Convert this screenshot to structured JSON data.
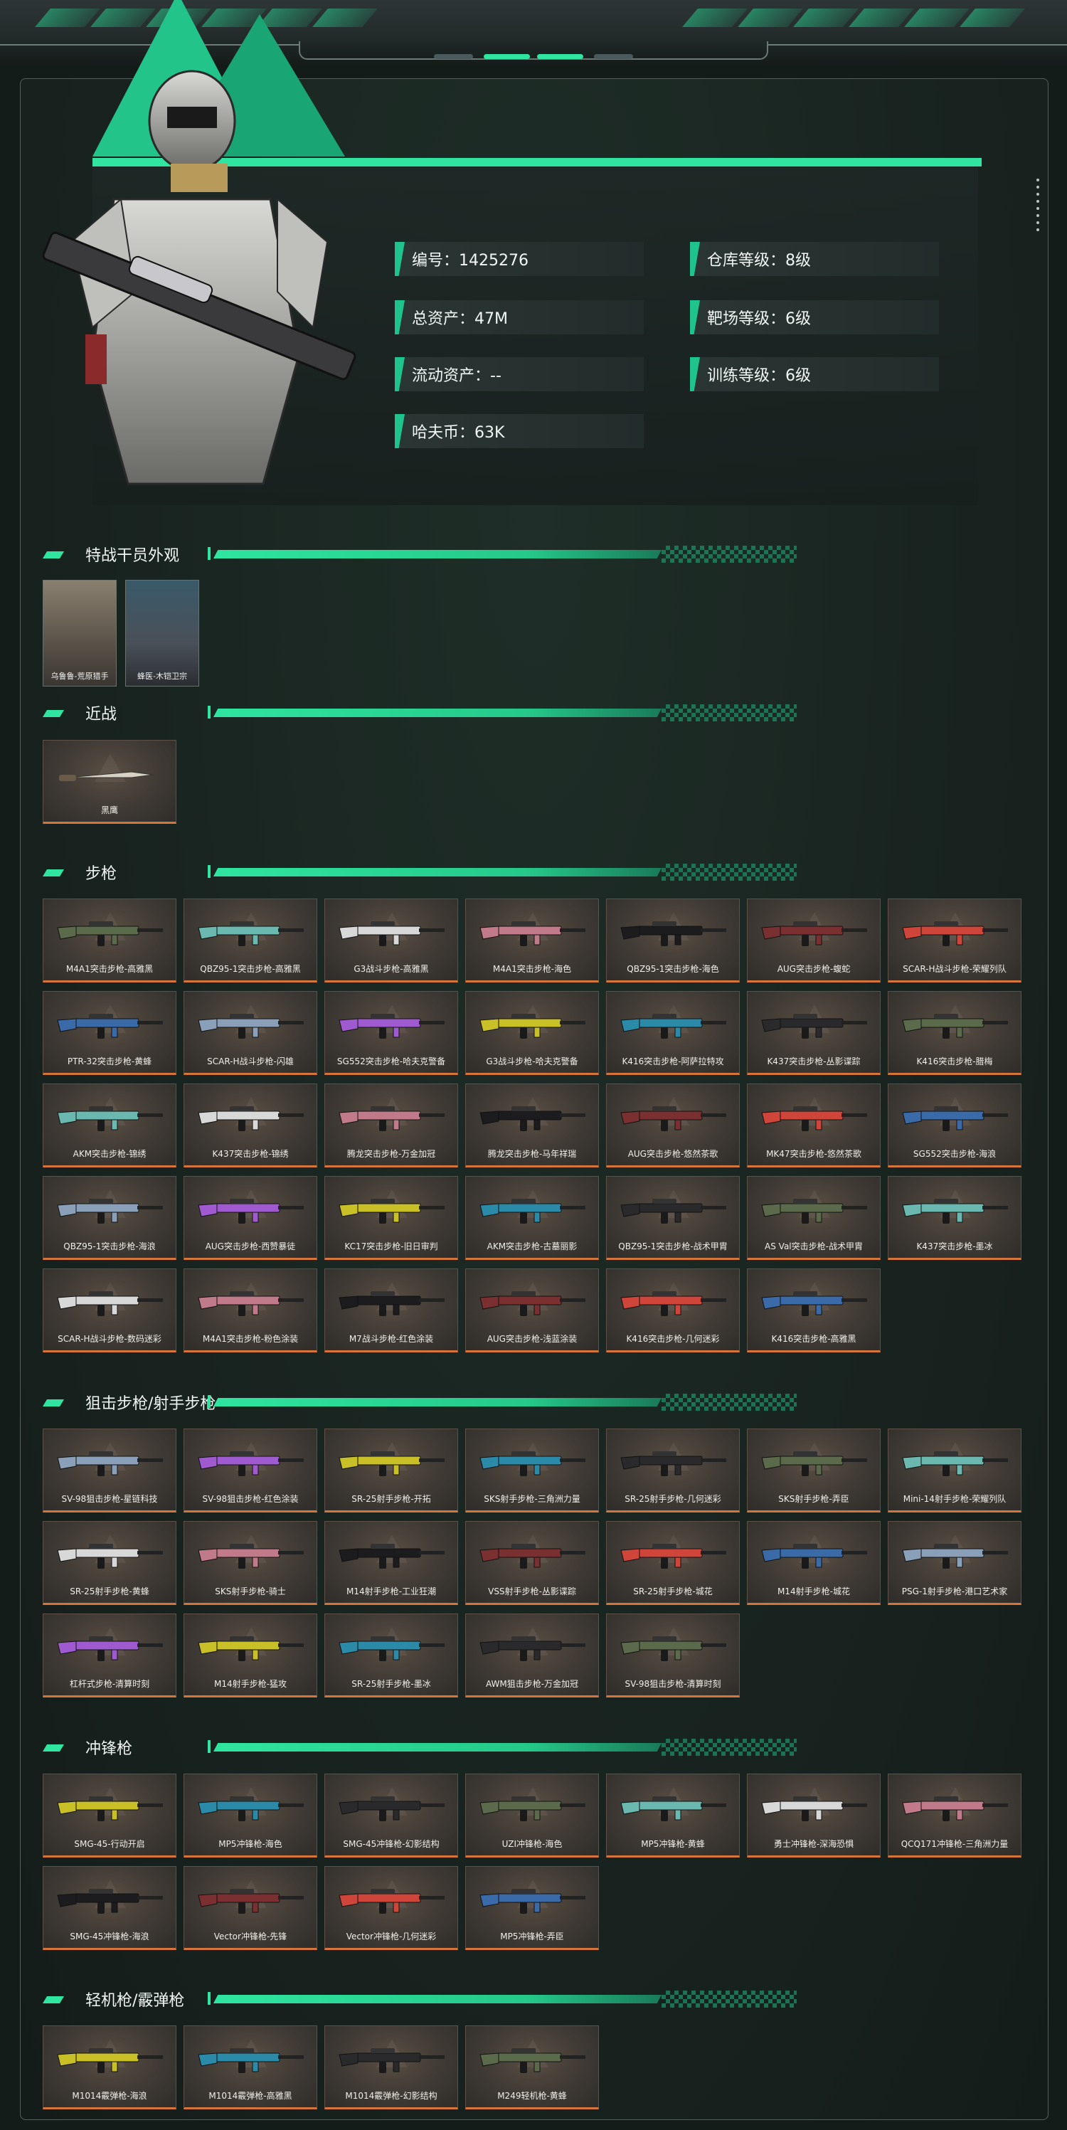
{
  "stats": [
    {
      "label": "编号：1425276"
    },
    {
      "label": "仓库等级：8级"
    },
    {
      "label": "总资产：47M"
    },
    {
      "label": "靶场等级：6级"
    },
    {
      "label": "流动资产：--"
    },
    {
      "label": "训练等级：6级"
    },
    {
      "label": "哈夫币：63K"
    }
  ],
  "sections": {
    "operators": {
      "title": "特战干员外观",
      "items": [
        "乌鲁鲁-荒原猎手",
        "蜂医-木铠卫宗"
      ]
    },
    "melee": {
      "title": "近战",
      "items": [
        "黑鹰"
      ]
    },
    "rifles": {
      "title": "步枪",
      "items": [
        "M4A1突击步枪-高雅黑",
        "QBZ95-1突击步枪-高雅黑",
        "G3战斗步枪-高雅黑",
        "M4A1突击步枪-海色",
        "QBZ95-1突击步枪-海色",
        "AUG突击步枪-蝮蛇",
        "SCAR-H战斗步枪-荣耀列队",
        "PTR-32突击步枪-黄蜂",
        "SCAR-H战斗步枪-闪雄",
        "SG552突击步枪-哈夫克警备",
        "G3战斗步枪-哈夫克警备",
        "K416突击步枪-阿萨拉特攻",
        "K437突击步枪-丛影谍踪",
        "K416突击步枪-腊梅",
        "AKM突击步枪-锦绣",
        "K437突击步枪-锦绣",
        "腾龙突击步枪-万金加冠",
        "腾龙突击步枪-马年祥瑞",
        "AUG突击步枪-悠然茶歌",
        "MK47突击步枪-悠然茶歌",
        "SG552突击步枪-海浪",
        "QBZ95-1突击步枪-海浪",
        "AUG突击步枪-西赞暴徒",
        "KC17突击步枪-旧日审判",
        "AKM突击步枪-古墓丽影",
        "QBZ95-1突击步枪-战术甲胄",
        "AS Val突击步枪-战术甲胄",
        "K437突击步枪-墨冰",
        "SCAR-H战斗步枪-数码迷彩",
        "M4A1突击步枪-粉色涂装",
        "M7战斗步枪-红色涂装",
        "AUG突击步枪-浅蓝涂装",
        "K416突击步枪-几何迷彩",
        "K416突击步枪-高雅黑"
      ]
    },
    "snipers": {
      "title": "狙击步枪/射手步枪",
      "items": [
        "SV-98狙击步枪-星链科技",
        "SV-98狙击步枪-红色涂装",
        "SR-25射手步枪-开拓",
        "SKS射手步枪-三角洲力量",
        "SR-25射手步枪-几何迷彩",
        "SKS射手步枪-弄臣",
        "Mini-14射手步枪-荣耀列队",
        "SR-25射手步枪-黄蜂",
        "SKS射手步枪-骑士",
        "M14射手步枪-工业狂潮",
        "VSS射手步枪-丛影谍踪",
        "SR-25射手步枪-城花",
        "M14射手步枪-城花",
        "PSG-1射手步枪-港口艺术家",
        "杠杆式步枪-清算时刻",
        "M14射手步枪-猛攻",
        "SR-25射手步枪-墨冰",
        "AWM狙击步枪-万金加冠",
        "SV-98狙击步枪-清算时刻"
      ]
    },
    "smgs": {
      "title": "冲锋枪",
      "items": [
        "SMG-45-行动开启",
        "MP5冲锋枪-海色",
        "SMG-45冲锋枪-幻影结构",
        "UZI冲锋枪-海色",
        "MP5冲锋枪-黄蜂",
        "勇士冲锋枪-深海恐惧",
        "QCQ171冲锋枪-三角洲力量",
        "SMG-45冲锋枪-海浪",
        "Vector冲锋枪-先锋",
        "Vector冲锋枪-几何迷彩",
        "MP5冲锋枪-弄臣"
      ]
    },
    "lmgs": {
      "title": "轻机枪/霰弹枪",
      "items": [
        "M1014霰弹枪-海浪",
        "M1014霰弹枪-高雅黑",
        "M1014霰弹枪-幻影结构",
        "M249轻机枪-黄蜂"
      ]
    }
  },
  "colors": {
    "accent": "#2fe5a0",
    "card_border_bottom": "#d6753a"
  },
  "icons": {
    "gun": "gun-icon",
    "knife": "knife-icon"
  }
}
